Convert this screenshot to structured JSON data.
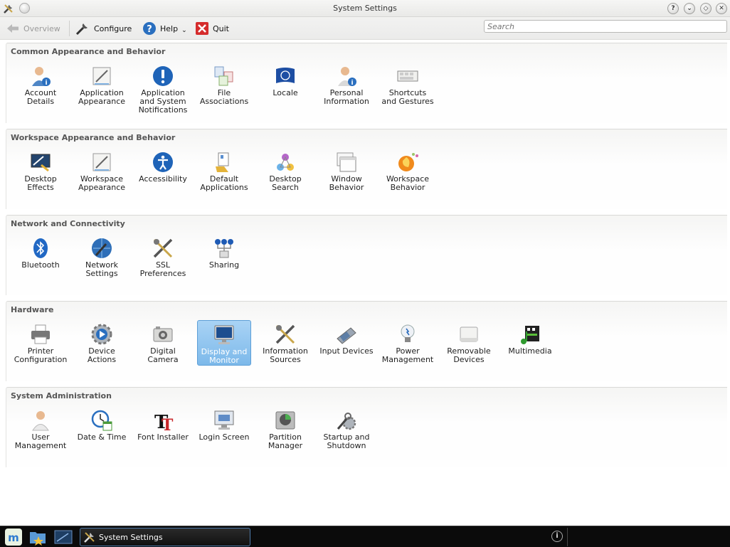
{
  "window": {
    "title": "System Settings"
  },
  "titlebar_buttons": [
    "?",
    "⌄",
    "◇",
    "✕"
  ],
  "toolbar": {
    "overview": "Overview",
    "configure": "Configure",
    "help": "Help",
    "help_arrow": "⌄",
    "quit": "Quit"
  },
  "search": {
    "placeholder": "Search"
  },
  "sections": [
    {
      "title": "Common Appearance and Behavior",
      "items": [
        {
          "label": "Account\nDetails",
          "icon": "account-icon"
        },
        {
          "label": "Application\nAppearance",
          "icon": "appearance-icon"
        },
        {
          "label": "Application\nand System\nNotifications",
          "icon": "notification-icon"
        },
        {
          "label": "File\nAssociations",
          "icon": "file-assoc-icon"
        },
        {
          "label": "Locale",
          "icon": "locale-icon"
        },
        {
          "label": "Personal\nInformation",
          "icon": "personal-icon"
        },
        {
          "label": "Shortcuts\nand Gestures",
          "icon": "shortcuts-icon"
        }
      ]
    },
    {
      "title": "Workspace Appearance and Behavior",
      "items": [
        {
          "label": "Desktop\nEffects",
          "icon": "desktop-effects-icon"
        },
        {
          "label": "Workspace\nAppearance",
          "icon": "appearance-icon"
        },
        {
          "label": "Accessibility",
          "icon": "accessibility-icon"
        },
        {
          "label": "Default\nApplications",
          "icon": "default-apps-icon"
        },
        {
          "label": "Desktop\nSearch",
          "icon": "desktop-search-icon"
        },
        {
          "label": "Window\nBehavior",
          "icon": "window-icon"
        },
        {
          "label": "Workspace\nBehavior",
          "icon": "workspace-behavior-icon"
        }
      ]
    },
    {
      "title": "Network and Connectivity",
      "items": [
        {
          "label": "Bluetooth",
          "icon": "bluetooth-icon"
        },
        {
          "label": "Network\nSettings",
          "icon": "network-icon"
        },
        {
          "label": "SSL\nPreferences",
          "icon": "tools-icon"
        },
        {
          "label": "Sharing",
          "icon": "sharing-icon"
        }
      ]
    },
    {
      "title": "Hardware",
      "items": [
        {
          "label": "Printer\nConfiguration",
          "icon": "printer-icon"
        },
        {
          "label": "Device\nActions",
          "icon": "device-actions-icon"
        },
        {
          "label": "Digital\nCamera",
          "icon": "camera-icon"
        },
        {
          "label": "Display and\nMonitor",
          "icon": "monitor-icon",
          "selected": true
        },
        {
          "label": "Information\nSources",
          "icon": "tools-icon"
        },
        {
          "label": "Input Devices",
          "icon": "input-devices-icon"
        },
        {
          "label": "Power\nManagement",
          "icon": "power-icon"
        },
        {
          "label": "Removable\nDevices",
          "icon": "removable-icon"
        },
        {
          "label": "Multimedia",
          "icon": "multimedia-icon"
        }
      ]
    },
    {
      "title": "System Administration",
      "items": [
        {
          "label": "User\nManagement",
          "icon": "user-icon"
        },
        {
          "label": "Date & Time",
          "icon": "clock-icon"
        },
        {
          "label": "Font Installer",
          "icon": "font-icon"
        },
        {
          "label": "Login Screen",
          "icon": "login-icon"
        },
        {
          "label": "Partition\nManager",
          "icon": "partition-icon"
        },
        {
          "label": "Startup and\nShutdown",
          "icon": "startup-icon"
        }
      ]
    }
  ],
  "taskbar": {
    "task_label": "System Settings",
    "info_glyph": "i"
  },
  "colors": {
    "selection": "#7db9ea",
    "accent": "#1f6fc2",
    "taskbar": "#0b0b0b"
  }
}
